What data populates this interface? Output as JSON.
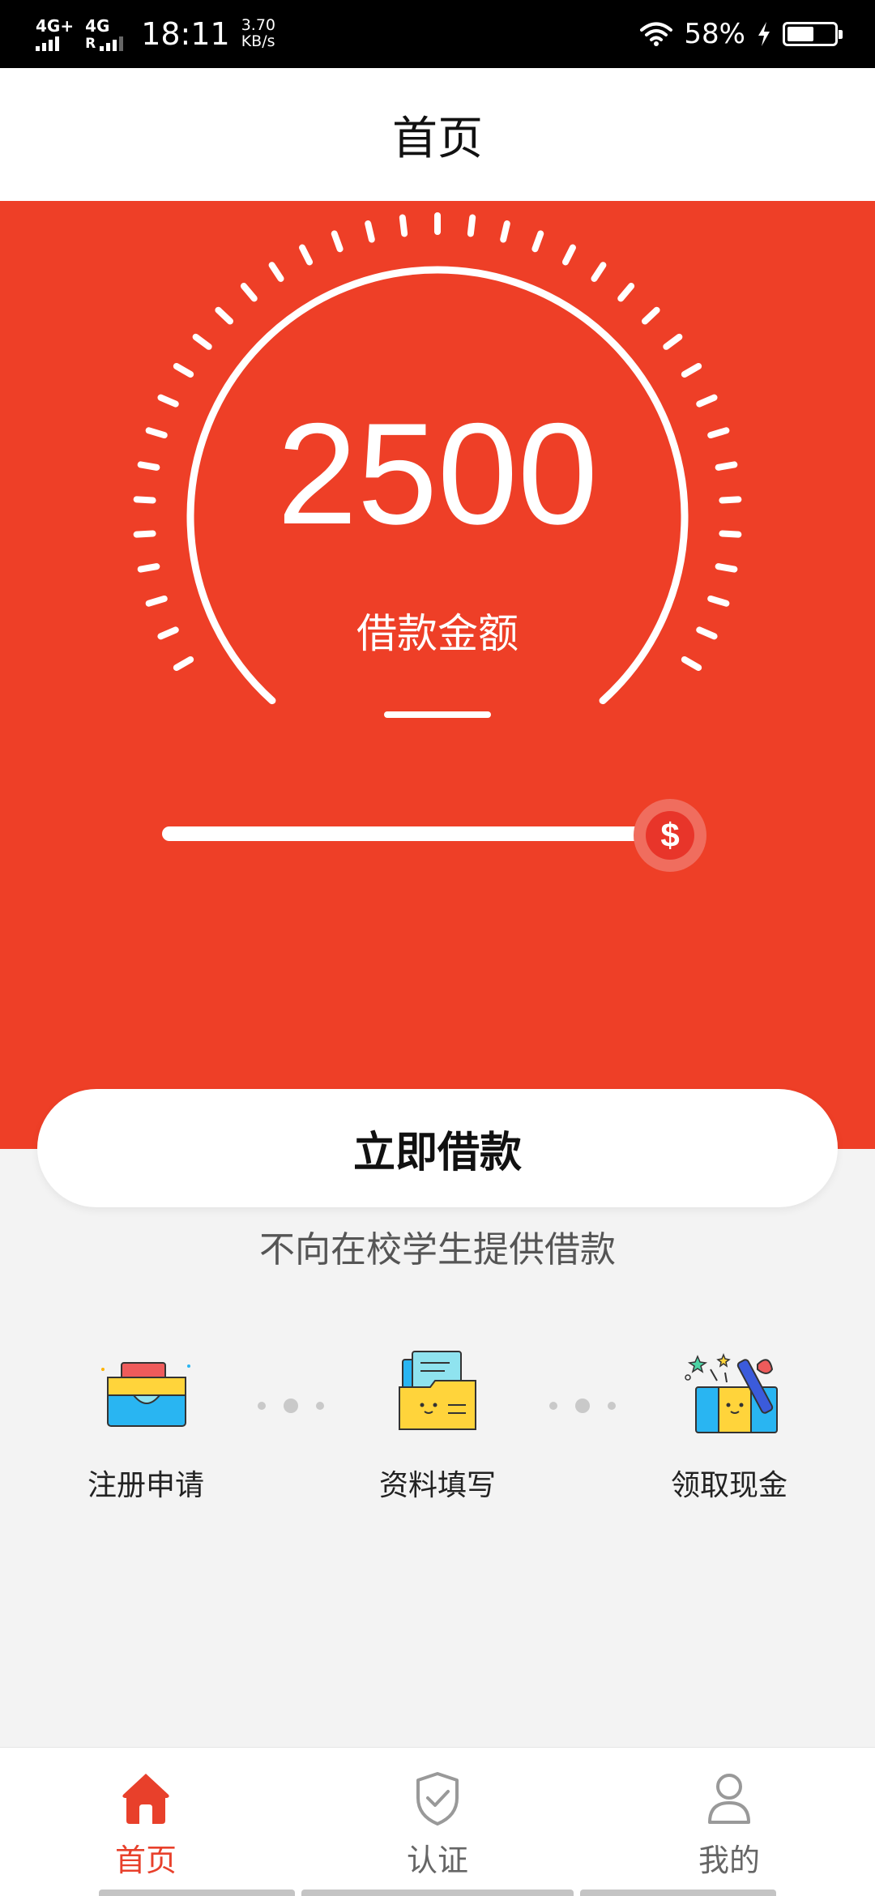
{
  "status_bar": {
    "network_1": "4G+",
    "network_2": "4G",
    "roaming": "R",
    "time": "18:11",
    "speed_value": "3.70",
    "speed_unit": "KB/s",
    "battery_percent": "58%",
    "battery_level": 0.58,
    "icons": [
      "signal-icon",
      "wifi-icon",
      "charging-icon",
      "battery-icon"
    ]
  },
  "header": {
    "title": "首页"
  },
  "loan": {
    "amount": "2500",
    "amount_label": "借款金额",
    "slider_level": 1.0,
    "slider_thumb_symbol": "$",
    "button_label": "立即借款",
    "notice": "不向在校学生提供借款"
  },
  "steps": [
    {
      "label": "注册申请",
      "icon": "register-folder-icon"
    },
    {
      "label": "资料填写",
      "icon": "documents-folder-icon"
    },
    {
      "label": "领取现金",
      "icon": "gift-box-icon"
    }
  ],
  "tabs": [
    {
      "label": "首页",
      "icon": "home-icon",
      "active": true
    },
    {
      "label": "认证",
      "icon": "shield-check-icon",
      "active": false
    },
    {
      "label": "我的",
      "icon": "user-icon",
      "active": false
    }
  ],
  "colors": {
    "brand_red": "#ee3f27",
    "active_tab": "#e8402b",
    "inactive_tab": "#666666",
    "page_background": "#f3f3f3"
  }
}
